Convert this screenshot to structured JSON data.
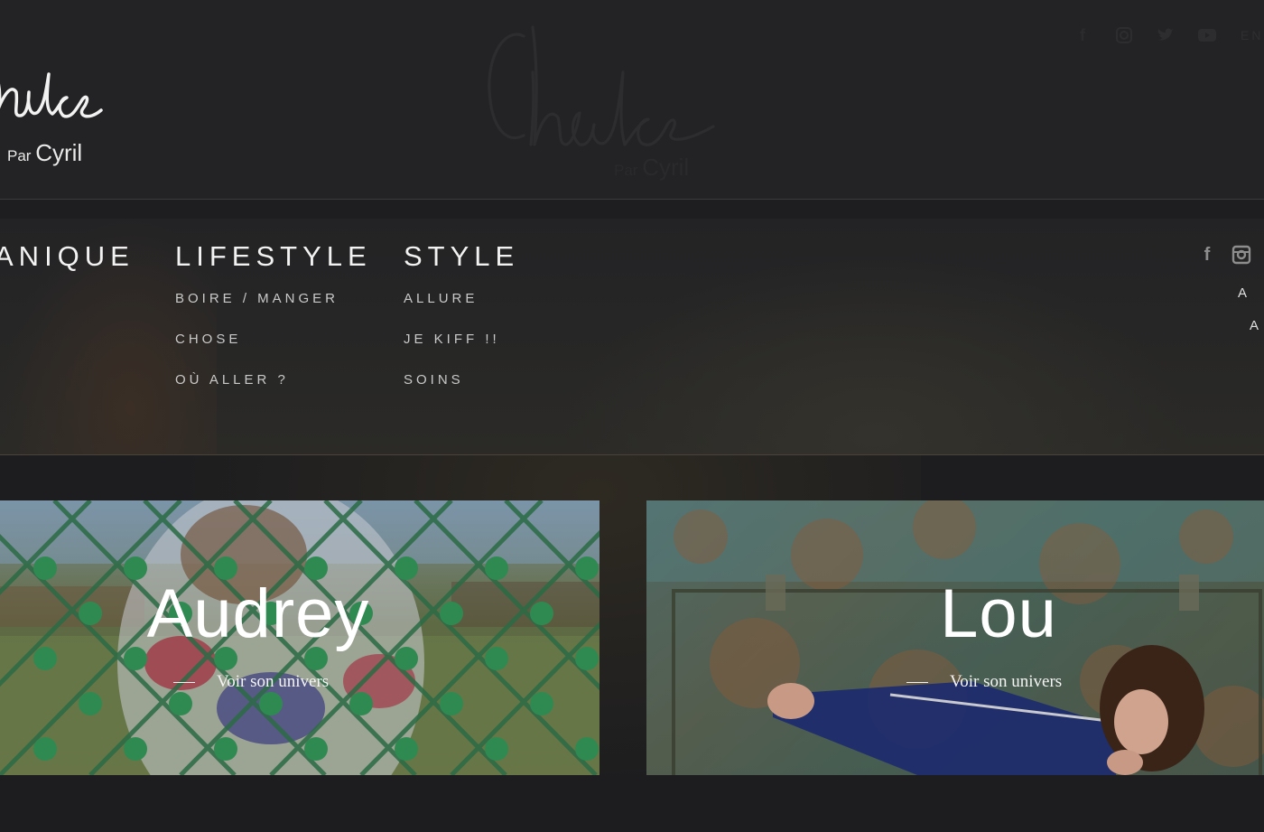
{
  "header": {
    "brand_left": {
      "script_text": "Chance",
      "par": "Par",
      "name": "Cyril"
    },
    "brand_center": {
      "script_text": "Chance",
      "par": "Par",
      "name": "Cyril"
    },
    "social_icons": [
      "facebook-icon",
      "instagram-icon",
      "twitter-icon",
      "youtube-icon"
    ],
    "language": "EN"
  },
  "menu": {
    "columns": [
      {
        "heading": "ANIQUE",
        "items": []
      },
      {
        "heading": "LIFESTYLE",
        "items": [
          "BOIRE / MANGER",
          "CHOSE",
          "OÙ ALLER ?"
        ]
      },
      {
        "heading": "STYLE",
        "items": [
          "ALLURE",
          "JE KIFF !!",
          "SOINS"
        ]
      }
    ],
    "right_social_icons": [
      "facebook-icon",
      "instagram-icon"
    ],
    "right_links": [
      "A P",
      "A"
    ]
  },
  "cards": [
    {
      "title": "Audrey",
      "link": "Voir son univers"
    },
    {
      "title": "Lou",
      "link": "Voir son univers"
    }
  ],
  "colors": {
    "header_bg": "#232325",
    "page_bg": "#1e1e20",
    "menu_text": "#c9c9c9",
    "heading_text": "#f2f2f2"
  }
}
